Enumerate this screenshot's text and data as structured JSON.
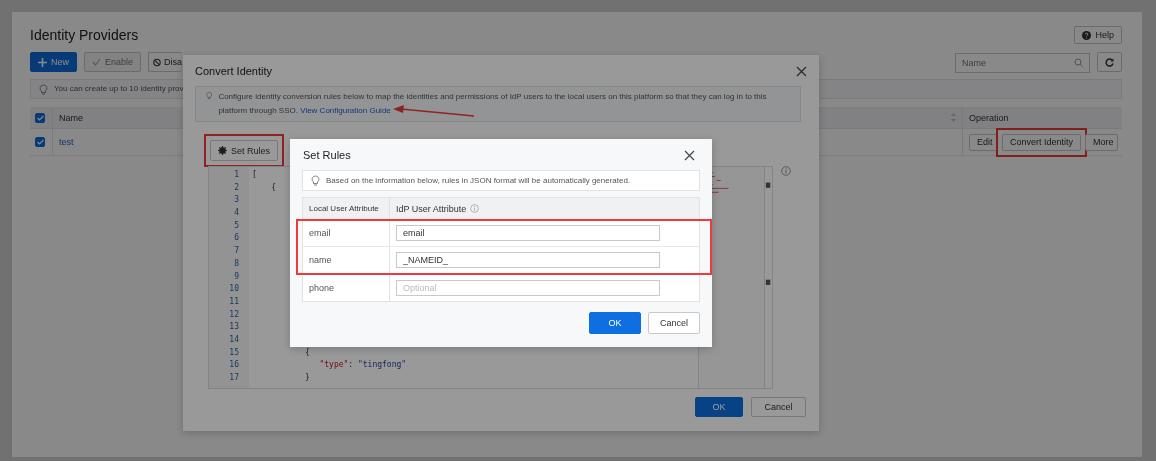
{
  "page": {
    "title": "Identity Providers",
    "help_button": "Help",
    "toolbar": [
      {
        "label": "New",
        "kind": "primary",
        "disabled": false
      },
      {
        "label": "Enable",
        "kind": "enable",
        "disabled": true
      },
      {
        "label": "Disa",
        "kind": "disable",
        "disabled": false
      }
    ],
    "search": {
      "placeholder": "Name"
    },
    "notice": "You can create up to 10 identity prov",
    "table": {
      "all_checked": true,
      "columns": [
        "Name",
        "Operation"
      ],
      "rows": [
        {
          "selected": true,
          "name": "test",
          "actions": [
            {
              "label": "Edit",
              "highlighted": false
            },
            {
              "label": "Convert Identity",
              "highlighted": true
            },
            {
              "label": "More",
              "highlighted": false
            }
          ]
        }
      ]
    }
  },
  "convert_dialog": {
    "title": "Convert Identity",
    "notice": "Configure identity conversion rules below to map the identities and permissions of IdP users to the local users on this platform so that they can log in to this platform through SSO.",
    "link": "View Configuration Guide",
    "set_rules_button": {
      "label": "Set Rules",
      "highlighted": true
    },
    "editor": [
      {
        "number": "1",
        "tokens": [
          {
            "kind": "punct",
            "text": "["
          }
        ]
      },
      {
        "number": "2",
        "tokens": [
          {
            "kind": "punct",
            "text": "    {"
          }
        ]
      },
      {
        "number": "3"
      },
      {
        "number": "4"
      },
      {
        "number": "5"
      },
      {
        "number": "6"
      },
      {
        "number": "7"
      },
      {
        "number": "8"
      },
      {
        "number": "9"
      },
      {
        "number": "10"
      },
      {
        "number": "11"
      },
      {
        "number": "12"
      },
      {
        "number": "13"
      },
      {
        "number": "14"
      },
      {
        "number": "15",
        "tokens": [
          {
            "kind": "punct",
            "text": "           {"
          }
        ]
      },
      {
        "number": "16",
        "tokens": [
          {
            "kind": "key",
            "text": "              \"type\""
          },
          {
            "kind": "punct",
            "text": ": "
          },
          {
            "kind": "string",
            "text": "\"tingfong\""
          }
        ]
      },
      {
        "number": "17",
        "tokens": [
          {
            "kind": "punct",
            "text": "           }"
          }
        ]
      }
    ],
    "buttons": [
      {
        "label": "OK",
        "kind": "primary"
      },
      {
        "label": "Cancel",
        "kind": "default"
      }
    ]
  },
  "set_rules_dialog": {
    "title": "Set Rules",
    "notice": "Based on the information below, rules in JSON format will be automatically generated.",
    "columns": [
      "Local User Attribute",
      "IdP User Attribute"
    ],
    "rows": [
      {
        "attribute": "email",
        "value": "email",
        "highlighted": true
      },
      {
        "attribute": "name",
        "value": "_NAMEID_",
        "highlighted": true
      },
      {
        "attribute": "phone",
        "placeholder": "Optional",
        "highlighted": false
      }
    ],
    "buttons": [
      {
        "label": "OK",
        "kind": "primary"
      },
      {
        "label": "Cancel",
        "kind": "default"
      }
    ]
  }
}
